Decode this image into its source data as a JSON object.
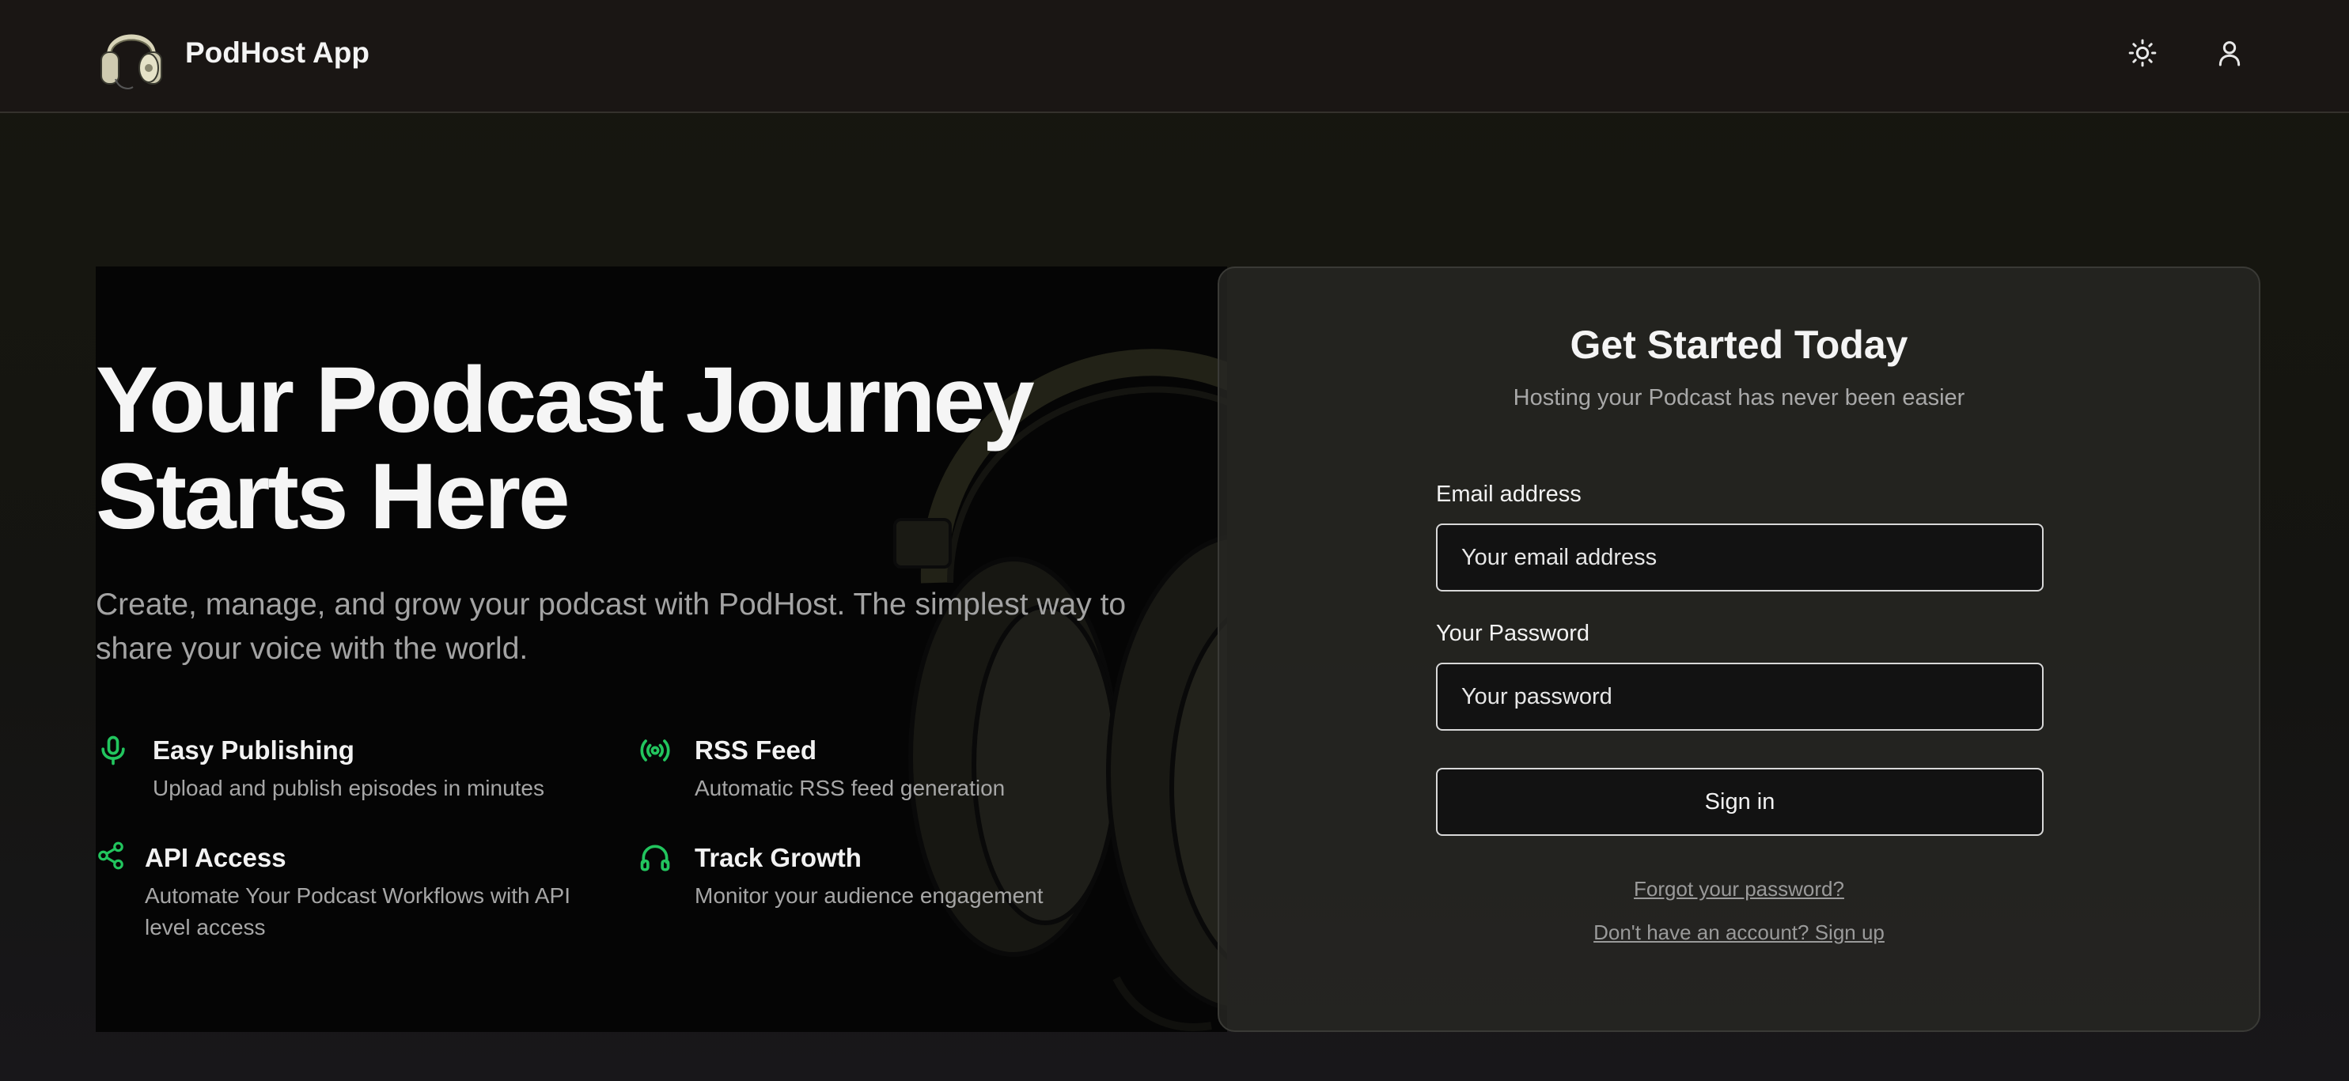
{
  "header": {
    "app_name": "PodHost App",
    "icons": {
      "logo": "headphones-logo",
      "theme": "sun-icon",
      "user": "user-icon"
    }
  },
  "hero": {
    "title_line1": "Your Podcast Journey",
    "title_line2": "Starts Here",
    "subtitle_line1": "Create, manage, and grow your podcast with PodHost. The simplest way to",
    "subtitle_line2": "share your voice with the world.",
    "features": [
      {
        "icon": "microphone-icon",
        "title": "Easy Publishing",
        "description": "Upload and publish episodes in minutes"
      },
      {
        "icon": "broadcast-icon",
        "title": "RSS Feed",
        "description": "Automatic RSS feed generation"
      },
      {
        "icon": "share-icon",
        "title": "API Access",
        "description_line1": "Automate Your Podcast Workflows with API",
        "description_line2": "level access"
      },
      {
        "icon": "headphones-icon",
        "title": "Track Growth",
        "description": "Monitor your audience engagement"
      }
    ]
  },
  "signin": {
    "title": "Get Started Today",
    "subtitle": "Hosting your Podcast has never been easier",
    "email_label": "Email address",
    "email_placeholder": "Your email address",
    "password_label": "Your Password",
    "password_placeholder": "Your password",
    "submit_label": "Sign in",
    "forgot_link": "Forgot your password?",
    "signup_link": "Don't have an account? Sign up"
  },
  "colors": {
    "accent": "#22c55e",
    "background": "#141411",
    "header_bg": "#1a1614",
    "card_bg": "#282824"
  }
}
